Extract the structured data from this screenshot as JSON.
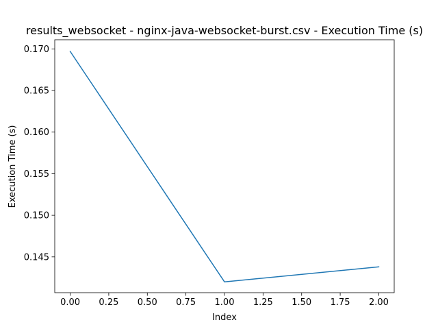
{
  "chart_data": {
    "type": "line",
    "title": "results_websocket - nginx-java-websocket-burst.csv - Execution Time (s)",
    "xlabel": "Index",
    "ylabel": "Execution Time (s)",
    "xlim": [
      -0.1,
      2.1
    ],
    "ylim": [
      0.1407,
      0.1711
    ],
    "xticks": [
      0.0,
      0.25,
      0.5,
      0.75,
      1.0,
      1.25,
      1.5,
      1.75,
      2.0
    ],
    "xtick_labels": [
      "0.00",
      "0.25",
      "0.50",
      "0.75",
      "1.00",
      "1.25",
      "1.50",
      "1.75",
      "2.00"
    ],
    "yticks": [
      0.145,
      0.15,
      0.155,
      0.16,
      0.165,
      0.17
    ],
    "ytick_labels": [
      "0.145",
      "0.150",
      "0.155",
      "0.160",
      "0.165",
      "0.170"
    ],
    "grid": false,
    "series": [
      {
        "color": "#1f77b4",
        "x": [
          0,
          1,
          2
        ],
        "y": [
          0.1697,
          0.142,
          0.1438
        ]
      }
    ]
  }
}
